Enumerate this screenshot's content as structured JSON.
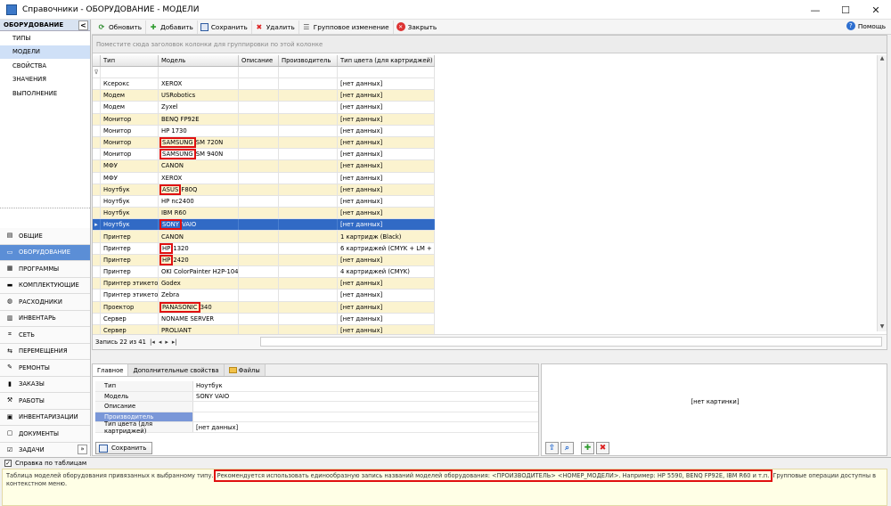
{
  "window": {
    "title": "Справочники - ОБОРУДОВАНИЕ - МОДЕЛИ",
    "minimize": "—",
    "maximize": "☐",
    "close": "✕"
  },
  "leftnav": {
    "header": "ОБОРУДОВАНИЕ",
    "collapse": "<",
    "subitems": [
      {
        "label": "ТИПЫ",
        "selected": false
      },
      {
        "label": "МОДЕЛИ",
        "selected": true
      },
      {
        "label": "СВОЙСТВА",
        "selected": false
      },
      {
        "label": "ЗНАЧЕНИЯ",
        "selected": false
      },
      {
        "label": "ВЫПОЛНЕНИЕ",
        "selected": false
      }
    ],
    "groups": [
      {
        "label": "ОБЩИЕ",
        "icon": "folder-icon",
        "selected": false
      },
      {
        "label": "ОБОРУДОВАНИЕ",
        "icon": "equipment-icon",
        "selected": true
      },
      {
        "label": "ПРОГРАММЫ",
        "icon": "programs-icon",
        "selected": false
      },
      {
        "label": "КОМПЛЕКТУЮЩИЕ",
        "icon": "components-icon",
        "selected": false
      },
      {
        "label": "РАСХОДНИКИ",
        "icon": "consumables-icon",
        "selected": false
      },
      {
        "label": "ИНВЕНТАРЬ",
        "icon": "inventory-icon",
        "selected": false
      },
      {
        "label": "СЕТЬ",
        "icon": "network-icon",
        "selected": false
      },
      {
        "label": "ПЕРЕМЕЩЕНИЯ",
        "icon": "transfers-icon",
        "selected": false
      },
      {
        "label": "РЕМОНТЫ",
        "icon": "repairs-icon",
        "selected": false
      },
      {
        "label": "ЗАКАЗЫ",
        "icon": "orders-icon",
        "selected": false
      },
      {
        "label": "РАБОТЫ",
        "icon": "works-icon",
        "selected": false
      },
      {
        "label": "ИНВЕНТАРИЗАЦИИ",
        "icon": "inventarization-icon",
        "selected": false
      },
      {
        "label": "ДОКУМЕНТЫ",
        "icon": "documents-icon",
        "selected": false
      },
      {
        "label": "ЗАДАЧИ",
        "icon": "tasks-icon",
        "selected": false
      }
    ],
    "more": "»"
  },
  "toolbar": {
    "refresh": "Обновить",
    "add": "Добавить",
    "save": "Сохранить",
    "delete": "Удалить",
    "group_change": "Групповое изменение",
    "close": "Закрыть",
    "help": "Помощь"
  },
  "grid": {
    "group_hint": "Поместите сюда заголовок колонки для группировки по этой колонке",
    "columns": [
      "Тип",
      "Модель",
      "Описание",
      "Производитель",
      "Тип цвета (для картриджей)"
    ],
    "rows": [
      {
        "type": "Ксерокс",
        "model": "XEROX",
        "mfr": "",
        "mfr_rest": "",
        "color": "[нет данных]"
      },
      {
        "type": "Модем",
        "model": "USRobotics",
        "mfr": "",
        "mfr_rest": "",
        "color": "[нет данных]"
      },
      {
        "type": "Модем",
        "model": "Zyxel",
        "mfr": "",
        "mfr_rest": "",
        "color": "[нет данных]"
      },
      {
        "type": "Монитор",
        "model": "BENQ FP92E",
        "mfr": "",
        "mfr_rest": "",
        "color": "[нет данных]"
      },
      {
        "type": "Монитор",
        "model": "HP 1730",
        "mfr": "",
        "mfr_rest": "",
        "color": "[нет данных]"
      },
      {
        "type": "Монитор",
        "model": "",
        "mfr": "SAMSUNG",
        "mfr_rest": " SM 720N",
        "color": "[нет данных]"
      },
      {
        "type": "Монитор",
        "model": "",
        "mfr": "SAMSUNG",
        "mfr_rest": " SM 940N",
        "color": "[нет данных]"
      },
      {
        "type": "МФУ",
        "model": "CANON",
        "mfr": "",
        "mfr_rest": "",
        "color": "[нет данных]"
      },
      {
        "type": "МФУ",
        "model": "XEROX",
        "mfr": "",
        "mfr_rest": "",
        "color": "[нет данных]"
      },
      {
        "type": "Ноутбук",
        "model": "",
        "mfr": "ASUS",
        "mfr_rest": " F80Q",
        "color": "[нет данных]"
      },
      {
        "type": "Ноутбук",
        "model": "HP nc2400",
        "mfr": "",
        "mfr_rest": "",
        "color": "[нет данных]"
      },
      {
        "type": "Ноутбук",
        "model": "IBM R60",
        "mfr": "",
        "mfr_rest": "",
        "color": "[нет данных]"
      },
      {
        "type": "Ноутбук",
        "model": "",
        "mfr": "SONY",
        "mfr_rest": " VAIO",
        "color": "[нет данных]",
        "selected": true
      },
      {
        "type": "Принтер",
        "model": "CANON",
        "mfr": "",
        "mfr_rest": "",
        "color": "1 картридж (Black)"
      },
      {
        "type": "Принтер",
        "model": "",
        "mfr": "HP",
        "mfr_rest": " 1320",
        "color": "6 картриджей (CMYK + LM + LC)"
      },
      {
        "type": "Принтер",
        "model": "",
        "mfr": "HP",
        "mfr_rest": " 2420",
        "color": "[нет данных]"
      },
      {
        "type": "Принтер",
        "model": "OKI ColorPainter H2P-104s",
        "mfr": "",
        "mfr_rest": "",
        "color": "4 картриджей (CMYK)"
      },
      {
        "type": "Принтер этикеток",
        "model": "Godex",
        "mfr": "",
        "mfr_rest": "",
        "color": "[нет данных]"
      },
      {
        "type": "Принтер этикеток",
        "model": "Zebra",
        "mfr": "",
        "mfr_rest": "",
        "color": "[нет данных]"
      },
      {
        "type": "Проектор",
        "model": "",
        "mfr": "PANASONIC",
        "mfr_rest": " 340",
        "color": "[нет данных]"
      },
      {
        "type": "Сервер",
        "model": "NONAME SERVER",
        "mfr": "",
        "mfr_rest": "",
        "color": "[нет данных]"
      },
      {
        "type": "Сервер",
        "model": "PROLIANT",
        "mfr": "",
        "mfr_rest": "",
        "color": "[нет данных]"
      }
    ],
    "record_info": "Запись 22 из 41"
  },
  "details": {
    "tabs": [
      "Главное",
      "Дополнительные свойства",
      "Файлы"
    ],
    "props": [
      {
        "name": "Тип",
        "value": "Ноутбук"
      },
      {
        "name": "Модель",
        "value": "SONY VAIO"
      },
      {
        "name": "Описание",
        "value": ""
      },
      {
        "name": "Производитель",
        "value": ""
      },
      {
        "name": "Тип цвета (для картриджей)",
        "value": "[нет данных]"
      }
    ],
    "save": "Сохранить"
  },
  "image_panel": {
    "no_image": "[нет картинки]"
  },
  "helpbar": {
    "checkbox_label": "Справка по таблицам",
    "text_before": "Таблица моделей оборудования привязанных к выбранному типу.",
    "text_highlight": "Рекомендуется использовать единообразную запись названий моделей оборудования: <ПРОИЗВОДИТЕЛЬ> <НОМЕР_МОДЕЛИ>. Например: HP 5590, BENQ FP92E, IBM R60 и т.п.",
    "text_after": "Групповые операции доступны в контекстном меню."
  }
}
